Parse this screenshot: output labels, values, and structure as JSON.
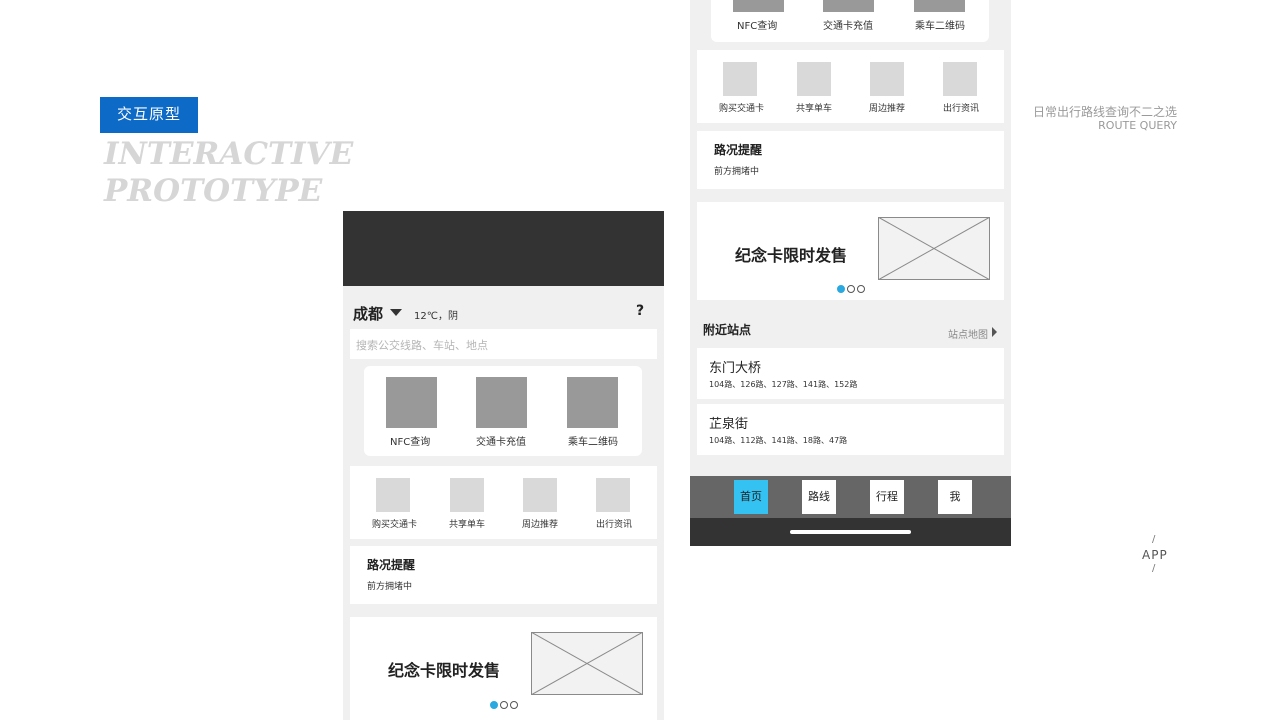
{
  "header": {
    "tag": "交互原型",
    "title_line1": "INTERACTIVE",
    "title_line2": "PROTOTYPE",
    "subtitle_cn": "日常出行路线查询不二之选",
    "subtitle_en": "ROUTE QUERY",
    "app_label": "APP",
    "slash": "/"
  },
  "screen1": {
    "city": "成都",
    "weather": "12℃，阴",
    "help": "?",
    "search_placeholder": "搜索公交线路、车站、地点",
    "main_actions": [
      "NFC查询",
      "交通卡充值",
      "乘车二维码"
    ],
    "sub_actions": [
      "购买交通卡",
      "共享单车",
      "周边推荐",
      "出行资讯"
    ],
    "traffic_title": "路况提醒",
    "traffic_text": "前方拥堵中",
    "promo_title": "纪念卡限时发售"
  },
  "screen2": {
    "main_actions": [
      "NFC查询",
      "交通卡充值",
      "乘车二维码"
    ],
    "sub_actions": [
      "购买交通卡",
      "共享单车",
      "周边推荐",
      "出行资讯"
    ],
    "traffic_title": "路况提醒",
    "traffic_text": "前方拥堵中",
    "promo_title": "纪念卡限时发售",
    "nearby_title": "附近站点",
    "nearby_map": "站点地图",
    "stations": [
      {
        "name": "东门大桥",
        "routes": "104路、126路、127路、141路、152路"
      },
      {
        "name": "芷泉街",
        "routes": "104路、112路、141路、18路、47路"
      }
    ],
    "nav": [
      "首页",
      "路线",
      "行程",
      "我"
    ],
    "active_nav": "首页"
  },
  "colors": {
    "accent": "#0d6ac6",
    "active_tab": "#33c2f2",
    "dark": "#333333"
  }
}
